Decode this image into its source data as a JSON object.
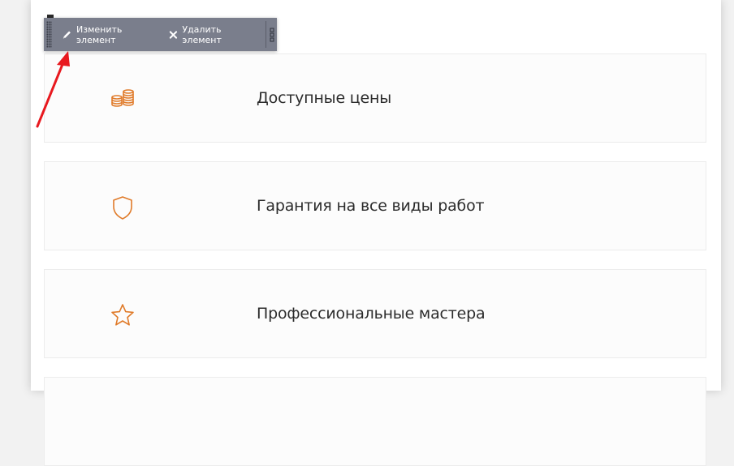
{
  "toolbar": {
    "edit_label": "Изменить элемент",
    "delete_label": "Удалить элемент"
  },
  "cards": [
    {
      "title": "Доступные цены",
      "icon": "coins-icon"
    },
    {
      "title": "Гарантия на все виды работ",
      "icon": "shield-icon"
    },
    {
      "title": "Профессиональные мастера",
      "icon": "star-icon"
    }
  ],
  "colors": {
    "accent": "#e07b2a",
    "toolbar_bg": "#7a7e8c",
    "annotation_arrow": "#e8191f"
  }
}
